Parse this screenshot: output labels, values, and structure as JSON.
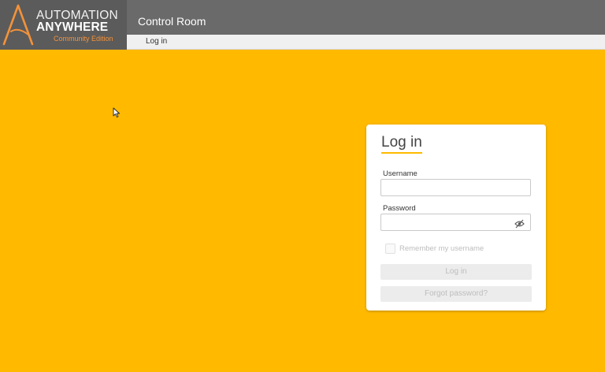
{
  "brand": {
    "line1": "AUTOMATION",
    "line2": "ANYWHERE",
    "edition": "Community Edition",
    "accent_color": "#ffba00",
    "edition_color": "#f3923a"
  },
  "header": {
    "title": "Control Room"
  },
  "breadcrumb": {
    "current": "Log in"
  },
  "login": {
    "title": "Log in",
    "username_label": "Username",
    "username_value": "",
    "password_label": "Password",
    "password_value": "",
    "show_password_icon": "eye-slash-icon",
    "remember_label": "Remember my username",
    "remember_checked": false,
    "login_button": "Log in",
    "forgot_button": "Forgot password?"
  },
  "colors": {
    "background": "#ffba00",
    "topbar": "#6a6a6a",
    "subbar": "#f0f0f0",
    "disabled_button": "#ececec"
  }
}
